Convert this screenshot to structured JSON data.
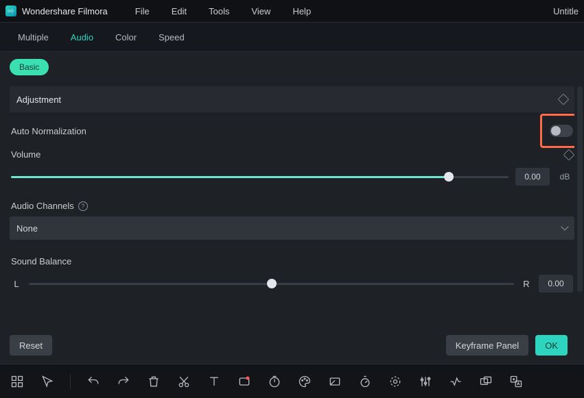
{
  "menubar": {
    "app_name": "Wondershare Filmora",
    "items": [
      "File",
      "Edit",
      "Tools",
      "View",
      "Help"
    ],
    "doc_title": "Untitle"
  },
  "tabs": {
    "items": [
      "Multiple",
      "Audio",
      "Color",
      "Speed"
    ],
    "active_index": 1
  },
  "subtabs": {
    "items": [
      "Basic"
    ],
    "active_index": 0
  },
  "section": {
    "title": "Adjustment"
  },
  "auto_norm": {
    "label": "Auto Normalization",
    "enabled": false,
    "highlighted": true
  },
  "volume": {
    "label": "Volume",
    "value_text": "0.00",
    "unit": "dB",
    "fill_percent": 88,
    "thumb_percent": 88
  },
  "audio_channels": {
    "label": "Audio Channels",
    "selected": "None"
  },
  "sound_balance": {
    "label": "Sound Balance",
    "left_label": "L",
    "right_label": "R",
    "value_text": "0.00",
    "thumb_percent": 50
  },
  "footer": {
    "reset": "Reset",
    "keyframe_panel": "Keyframe Panel",
    "ok": "OK"
  },
  "toolbar": {
    "tools": [
      "layout-grid",
      "pointer",
      "|",
      "undo",
      "redo",
      "delete",
      "cut",
      "text",
      "record",
      "timer",
      "color-palette",
      "subtitle",
      "stopwatch",
      "effects",
      "mixer",
      "volume-curve",
      "group",
      "translate"
    ]
  }
}
